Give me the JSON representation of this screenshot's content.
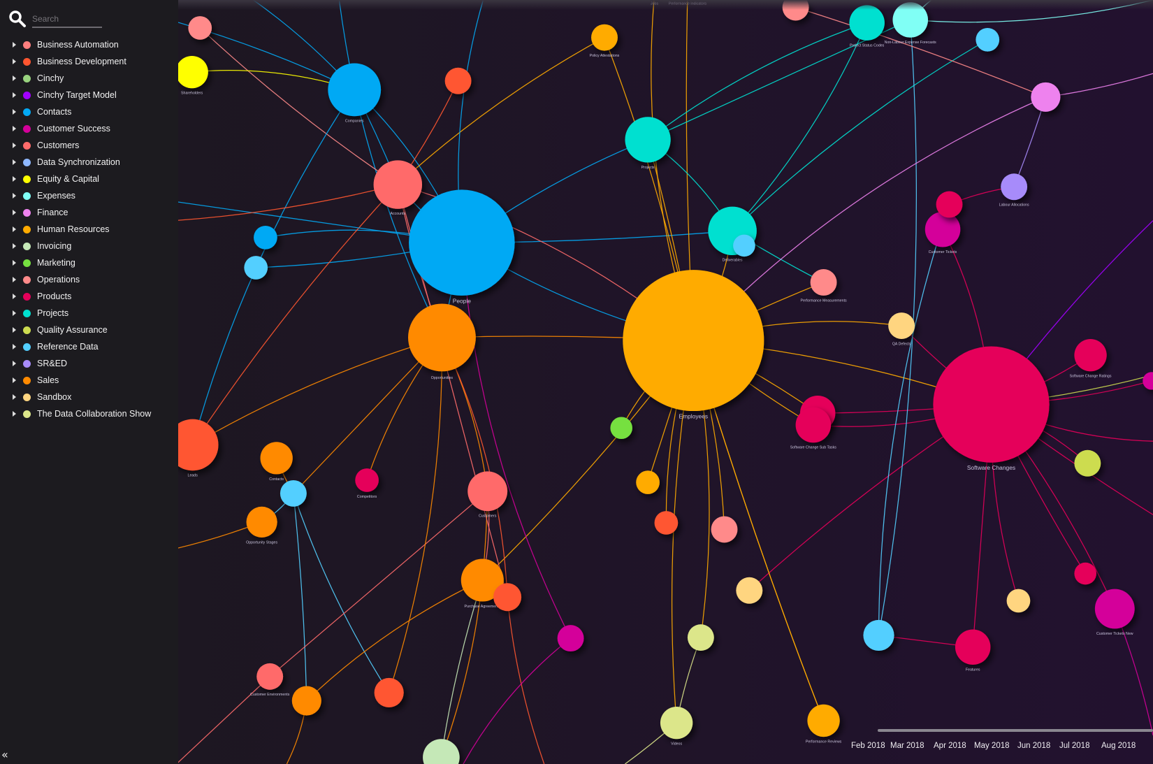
{
  "search": {
    "placeholder": "Search",
    "value": ""
  },
  "sidebar": {
    "items": [
      {
        "label": "Business Automation",
        "color": "#ff7f7f"
      },
      {
        "label": "Business Development",
        "color": "#ff5630"
      },
      {
        "label": "Cinchy",
        "color": "#99d37f"
      },
      {
        "label": "Cinchy Target Model",
        "color": "#a200ff"
      },
      {
        "label": "Contacts",
        "color": "#03a9f4"
      },
      {
        "label": "Customer Success",
        "color": "#d4009a"
      },
      {
        "label": "Customers",
        "color": "#ff6b6b"
      },
      {
        "label": "Data Synchronization",
        "color": "#8fb8ff"
      },
      {
        "label": "Equity & Capital",
        "color": "#ffff00"
      },
      {
        "label": "Expenses",
        "color": "#80fff5"
      },
      {
        "label": "Finance",
        "color": "#ee82ee"
      },
      {
        "label": "Human Resources",
        "color": "#ffab00"
      },
      {
        "label": "Invoicing",
        "color": "#c5e8b7"
      },
      {
        "label": "Marketing",
        "color": "#76e040"
      },
      {
        "label": "Operations",
        "color": "#ff8a8a"
      },
      {
        "label": "Products",
        "color": "#e5005a"
      },
      {
        "label": "Projects",
        "color": "#00e0d0"
      },
      {
        "label": "Quality Assurance",
        "color": "#cddc50"
      },
      {
        "label": "Reference Data",
        "color": "#53cfff"
      },
      {
        "label": "SR&ED",
        "color": "#a78bfa"
      },
      {
        "label": "Sales",
        "color": "#ff8a00"
      },
      {
        "label": "Sandbox",
        "color": "#ffd580"
      },
      {
        "label": "The Data Collaboration Show",
        "color": "#dce68a"
      }
    ],
    "collapse_icon": "double-chevron-left-icon"
  },
  "graph": {
    "nodes": [
      {
        "label": "Companies",
        "color": "#03a9f4"
      },
      {
        "label": "People",
        "color": "#03a9f4"
      },
      {
        "label": "Accounts",
        "color": "#ff6b6b"
      },
      {
        "label": "Opportunities",
        "color": "#ff8a00"
      },
      {
        "label": "Employees",
        "color": "#ffab00"
      },
      {
        "label": "Software Changes",
        "color": "#e5005a"
      },
      {
        "label": "Projects",
        "color": "#00e0d0"
      },
      {
        "label": "Deliverables",
        "color": "#00e0d0"
      },
      {
        "label": "Leads",
        "color": "#ff5630"
      },
      {
        "label": "Contacts",
        "color": "#ff8a00"
      },
      {
        "label": "",
        "color": "#53cfff"
      },
      {
        "label": "Opportunity Stages",
        "color": "#ff8a00"
      },
      {
        "label": "Competitors",
        "color": "#e5005a"
      },
      {
        "label": "Customers",
        "color": "#ff6b6b"
      },
      {
        "label": "Purchase Agreements",
        "color": "#ff8a00"
      },
      {
        "label": "",
        "color": "#ff5630"
      },
      {
        "label": "Customer Environments",
        "color": "#ff6b6b"
      },
      {
        "label": "",
        "color": "#ff8a00"
      },
      {
        "label": "",
        "color": "#ff5630"
      },
      {
        "label": "",
        "color": "#c5e8b7"
      },
      {
        "label": "Videos",
        "color": "#dce68a"
      },
      {
        "label": "",
        "color": "#dce68a"
      },
      {
        "label": "",
        "color": "#ffd580"
      },
      {
        "label": "",
        "color": "#d4009a"
      },
      {
        "label": "",
        "color": "#76e040"
      },
      {
        "label": "",
        "color": "#ffab00"
      },
      {
        "label": "",
        "color": "#ff5630"
      },
      {
        "label": "",
        "color": "#ff8a8a"
      },
      {
        "label": "Performance Reviews",
        "color": "#ffab00"
      },
      {
        "label": "",
        "color": "#53cfff"
      },
      {
        "label": "Features",
        "color": "#e5005a"
      },
      {
        "label": "",
        "color": "#ffd580"
      },
      {
        "label": "Customer Tickets New",
        "color": "#d4009a"
      },
      {
        "label": "",
        "color": "#e5005a"
      },
      {
        "label": "",
        "color": "#cddc50"
      },
      {
        "label": "Software Change Ratings",
        "color": "#e5005a"
      },
      {
        "label": "",
        "color": "#d4009a"
      },
      {
        "label": "",
        "color": "#e5005a"
      },
      {
        "label": "Software Change Sub Tasks",
        "color": "#e5005a"
      },
      {
        "label": "QA Defects",
        "color": "#ffd580"
      },
      {
        "label": "Performance Measurements",
        "color": "#ff8a8a"
      },
      {
        "label": "Customer Tickets",
        "color": "#d4009a"
      },
      {
        "label": "",
        "color": "#e5005a"
      },
      {
        "label": "Labour Allocations",
        "color": "#a78bfa"
      },
      {
        "label": "",
        "color": "#ee82ee"
      },
      {
        "label": "",
        "color": "#53cfff"
      },
      {
        "label": "Non-Labour Expense Forecasts",
        "color": "#80fff5"
      },
      {
        "label": "Project Status Codes",
        "color": "#00e0d0"
      },
      {
        "label": "",
        "color": "#ff8a8a"
      },
      {
        "label": "Policy Attestations",
        "color": "#ffab00"
      },
      {
        "label": "",
        "color": "#ff5630"
      },
      {
        "label": "",
        "color": "#ff8a8a"
      },
      {
        "label": "Shareholders",
        "color": "#ffff00"
      },
      {
        "label": "",
        "color": "#03a9f4"
      },
      {
        "label": "",
        "color": "#53cfff"
      },
      {
        "label": "",
        "color": "#53cfff"
      },
      {
        "label": "Jobs",
        "color": "#ffab00"
      },
      {
        "label": "Performance Indicators",
        "color": "#ff8a8a"
      }
    ]
  },
  "timeline": {
    "ticks": [
      "Feb 2018",
      "Mar 2018",
      "Apr 2018",
      "May 2018",
      "Jun 2018",
      "Jul 2018",
      "Aug 2018"
    ]
  }
}
